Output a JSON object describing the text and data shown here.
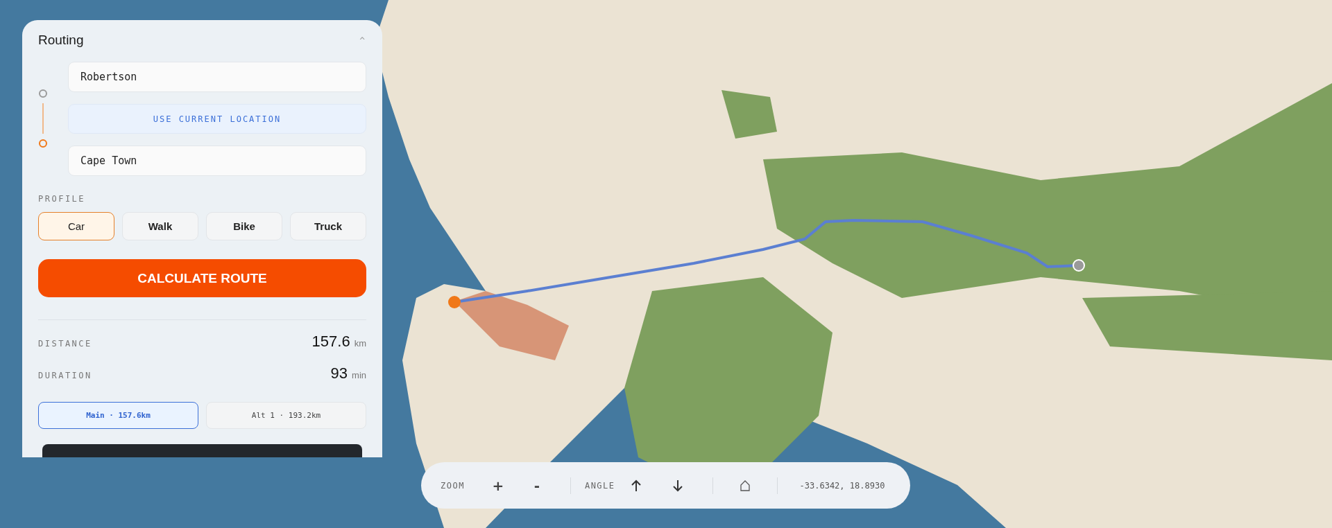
{
  "panel": {
    "title": "Routing",
    "collapse_glyph": "^",
    "stops": [
      {
        "kind": "start",
        "value": "Robertson"
      },
      {
        "kind": "end",
        "value": "Cape Town"
      }
    ],
    "use_location": "USE CURRENT LOCATION",
    "profile_label": "PROFILE",
    "profiles": [
      {
        "label": "Car",
        "selected": true
      },
      {
        "label": "Walk",
        "selected": false
      },
      {
        "label": "Bike",
        "selected": false
      },
      {
        "label": "Truck",
        "selected": false
      }
    ],
    "calculate": "CALCULATE ROUTE",
    "stats": [
      {
        "label": "DISTANCE",
        "value": "157.6",
        "unit": "km"
      },
      {
        "label": "DURATION",
        "value": "93",
        "unit": "min"
      }
    ],
    "routes": [
      {
        "label": "Main · 157.6km",
        "selected": true
      },
      {
        "label": "Alt 1 · 193.2km",
        "selected": false
      }
    ]
  },
  "toolbar": {
    "zoom_label": "ZOOM",
    "zoom_in": "+",
    "zoom_out": "-",
    "angle_label": "ANGLE",
    "coordinates": "-33.6342, 18.8930"
  }
}
